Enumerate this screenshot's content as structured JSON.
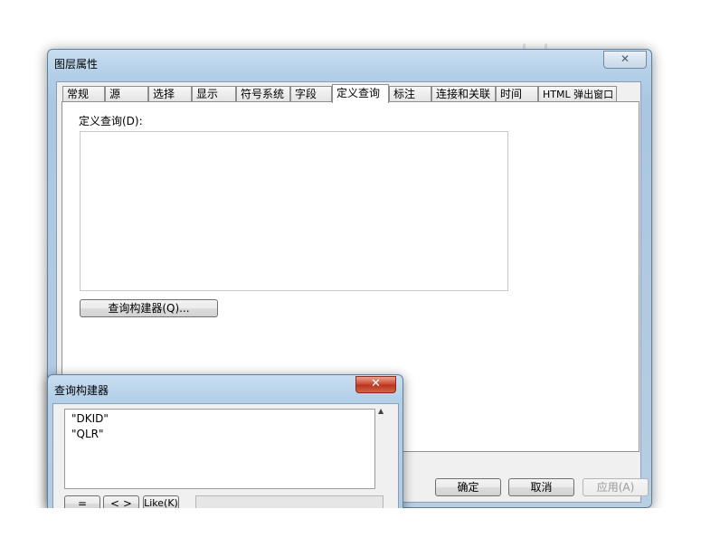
{
  "layer_properties": {
    "title": "图层属性",
    "close_label": "✕",
    "tabs": [
      {
        "label": "常规"
      },
      {
        "label": "源"
      },
      {
        "label": "选择"
      },
      {
        "label": "显示"
      },
      {
        "label": "符号系统"
      },
      {
        "label": "字段"
      },
      {
        "label": "定义查询"
      },
      {
        "label": "标注"
      },
      {
        "label": "连接和关联"
      },
      {
        "label": "时间"
      },
      {
        "label": "HTML 弹出窗口"
      }
    ],
    "active_tab": "定义查询",
    "definition_query_label": "定义查询(D):",
    "definition_query_value": "",
    "query_builder_button": "查询构建器(Q)...",
    "ok_button": "确定",
    "cancel_button": "取消",
    "apply_button": "应用(A)"
  },
  "query_builder": {
    "title": "查询构建器",
    "close_label": "✕",
    "fields": [
      "\"DKID\"",
      "\"QLR\""
    ],
    "operators": {
      "equals": "=",
      "not_equals": "< >",
      "like": "Like(K)"
    }
  }
}
